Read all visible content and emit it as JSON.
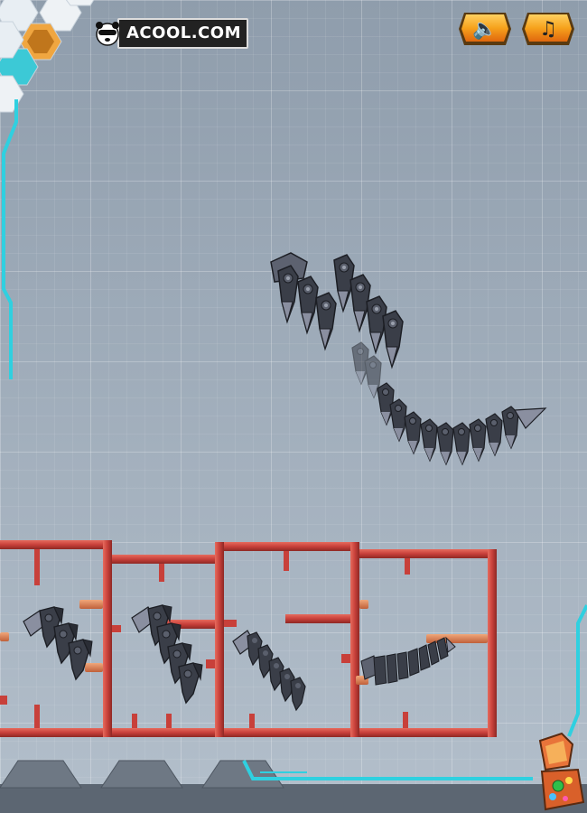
{
  "brand": {
    "logo_text": "ACOOL.COM"
  },
  "hud": {
    "sound_icon": "speaker-icon",
    "music_icon": "music-note-icon",
    "sound_glyph": "🔈",
    "music_glyph": "♫"
  },
  "colors": {
    "accent_cyan": "#2fd0e0",
    "button_orange": "#f29a1a",
    "frame_red": "#c8403a",
    "robot_metal": "#3a3e48"
  },
  "parts": [
    {
      "name": "tail-segment-claws-1"
    },
    {
      "name": "tail-segment-claws-2"
    },
    {
      "name": "tail-segment-spine-3"
    },
    {
      "name": "tail-spine-chain-4"
    }
  ]
}
